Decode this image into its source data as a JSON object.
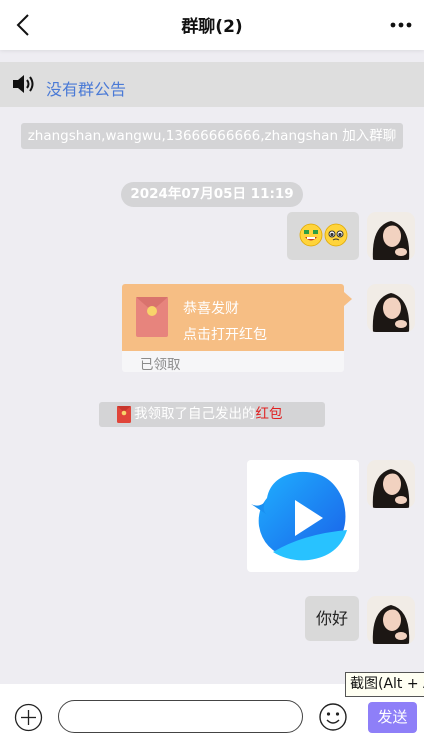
{
  "header": {
    "title": "群聊(2)"
  },
  "announcement": {
    "text": "没有群公告"
  },
  "messages": {
    "join_notice": "zhangshan,wangwu,13666666666,zhangshan 加入群聊",
    "timestamp": "2024年07月05日 11:19",
    "red_packet": {
      "title": "恭喜发财",
      "subtitle": "点击打开红包",
      "status": "已领取"
    },
    "red_packet_notice": {
      "prefix": "我领取了自己发出的",
      "link": "红包"
    },
    "text_message": "你好"
  },
  "tooltip": "截图(Alt + A",
  "input_bar": {
    "placeholder": "",
    "send_label": "发送"
  },
  "colors": {
    "accent": "#8e7ff8",
    "link": "#4a7ad6",
    "red_packet": "#f6be84",
    "highlight_red": "#e02020"
  }
}
